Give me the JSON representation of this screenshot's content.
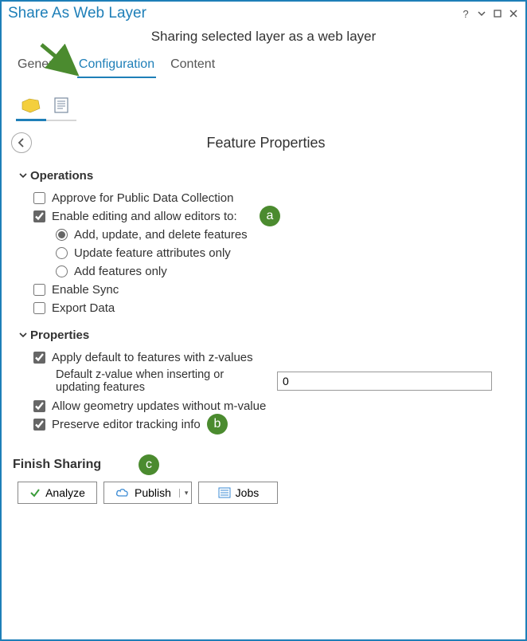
{
  "window": {
    "title": "Share As Web Layer",
    "subtitle": "Sharing selected layer as a web layer"
  },
  "tabs": {
    "general": "General",
    "configuration": "Configuration",
    "content": "Content"
  },
  "section_title": "Feature Properties",
  "operations": {
    "header": "Operations",
    "approve_public": "Approve for Public Data Collection",
    "enable_editing": "Enable editing and allow editors to:",
    "radio_addupdatedelete": "Add, update, and delete features",
    "radio_updateattrs": "Update feature attributes only",
    "radio_addonly": "Add features only",
    "enable_sync": "Enable Sync",
    "export_data": "Export Data"
  },
  "properties": {
    "header": "Properties",
    "apply_z": "Apply default to features with z-values",
    "z_label": "Default z-value when inserting or updating features",
    "z_value": "0",
    "allow_geom_m": "Allow geometry updates without m-value",
    "preserve_tracking": "Preserve editor tracking info"
  },
  "finish": {
    "header": "Finish Sharing",
    "analyze": "Analyze",
    "publish": "Publish",
    "jobs": "Jobs"
  },
  "badges": {
    "a": "a",
    "b": "b",
    "c": "c"
  }
}
